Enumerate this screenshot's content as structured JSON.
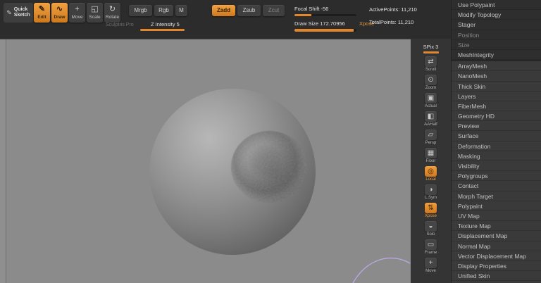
{
  "colors": {
    "accent": "#e0862f",
    "canvas_gray": "#8b8b8b"
  },
  "topbar": {
    "quicksketch_icon": "✎",
    "quicksketch_line1": "Quick",
    "quicksketch_line2": "Sketch",
    "tools": [
      {
        "label": "Edit",
        "icon": "✎"
      },
      {
        "label": "Draw",
        "icon": "∿"
      },
      {
        "label": "Move",
        "icon": "+"
      },
      {
        "label": "Scale",
        "icon": "◱"
      },
      {
        "label": "Rotate",
        "icon": "↻"
      }
    ],
    "color_modes": [
      "Mrgb",
      "Rgb",
      "M"
    ],
    "sculpt_modes": [
      "Zadd",
      "Zsub",
      "Zcut"
    ],
    "sculptris_pro": "Sculptris Pro",
    "focal_shift": "Focal Shift  -56",
    "z_intensity": "Z Intensity 5",
    "draw_size": "Draw Size  172.70956",
    "xpose": "Xpose",
    "active_points": "ActivePoints: 11,210",
    "total_points": "TotalPoints: 11,210"
  },
  "shelf": {
    "spix": "SPix 3",
    "items": [
      {
        "name": "scroll",
        "icon": "⇄",
        "label": "Scroll"
      },
      {
        "name": "zoom",
        "icon": "⊙",
        "label": "Zoom"
      },
      {
        "name": "actual",
        "icon": "▣",
        "label": "Actual"
      },
      {
        "name": "aahalf",
        "icon": "◧",
        "label": "AAHalf"
      },
      {
        "name": "persp",
        "icon": "▱",
        "label": "Persp"
      },
      {
        "name": "floor",
        "icon": "▦",
        "label": "Floor"
      },
      {
        "name": "local",
        "icon": "◎",
        "label": "Local"
      },
      {
        "name": "lsym",
        "icon": "◑",
        "label": "L.Sym"
      },
      {
        "name": "xpose",
        "icon": "⇅",
        "label": "Xpose"
      },
      {
        "name": "solo",
        "icon": "◒",
        "label": "Solo"
      },
      {
        "name": "frame",
        "icon": "▭",
        "label": "Frame"
      },
      {
        "name": "move",
        "icon": "+",
        "label": "Move"
      }
    ]
  },
  "panel": {
    "top_items": [
      {
        "label": "Use Polypaint"
      },
      {
        "label": "Modify Topology"
      },
      {
        "label": "Stager"
      },
      {
        "label": "Position"
      },
      {
        "label": "Size"
      },
      {
        "label": "MeshIntegrity"
      }
    ],
    "items": [
      "ArrayMesh",
      "NanoMesh",
      "Thick Skin",
      "Layers",
      "FiberMesh",
      "Geometry HD",
      "Preview",
      "Surface",
      "Deformation",
      "Masking",
      "Visibility",
      "Polygroups",
      "Contact",
      "Morph Target",
      "Polypaint",
      "UV Map",
      "Texture Map",
      "Displacement Map",
      "Normal Map",
      "Vector Displacement Map",
      "Display Properties",
      "Unified Skin"
    ]
  }
}
